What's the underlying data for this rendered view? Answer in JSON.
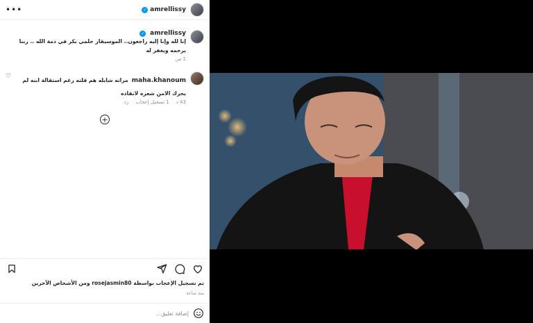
{
  "header": {
    "username": "amrellissy",
    "more_icon": "more-horizontal-icon"
  },
  "caption": {
    "username": "amrellissy",
    "text": "إنا لله وإنا إليه راجعون.. الموسيقار حلمي بكر في ذمة الله .. ربنا يرحمه ويغفر له",
    "time": "1 س"
  },
  "comments": [
    {
      "username": "maha.khanoum",
      "text": "مراته شايله هم قلته رغم استقالة ابنه لم يحرك الامن شعره لانقاذه",
      "time": "43 د",
      "likes": "1 تسجيل إعجاب",
      "reply": "رد"
    }
  ],
  "post": {
    "likes_text": "تم تسجيل الإعجاب بواسطة rosejasmin80 ومن الأشخاص الآخرين",
    "time_text": "منذ ساعة"
  },
  "add_comment": {
    "placeholder": "إضافة تعليق..."
  },
  "colors": {
    "verified": "#0095f6",
    "text": "#262626",
    "muted": "#8e8e8e",
    "red_shirt": "#c8102e"
  }
}
